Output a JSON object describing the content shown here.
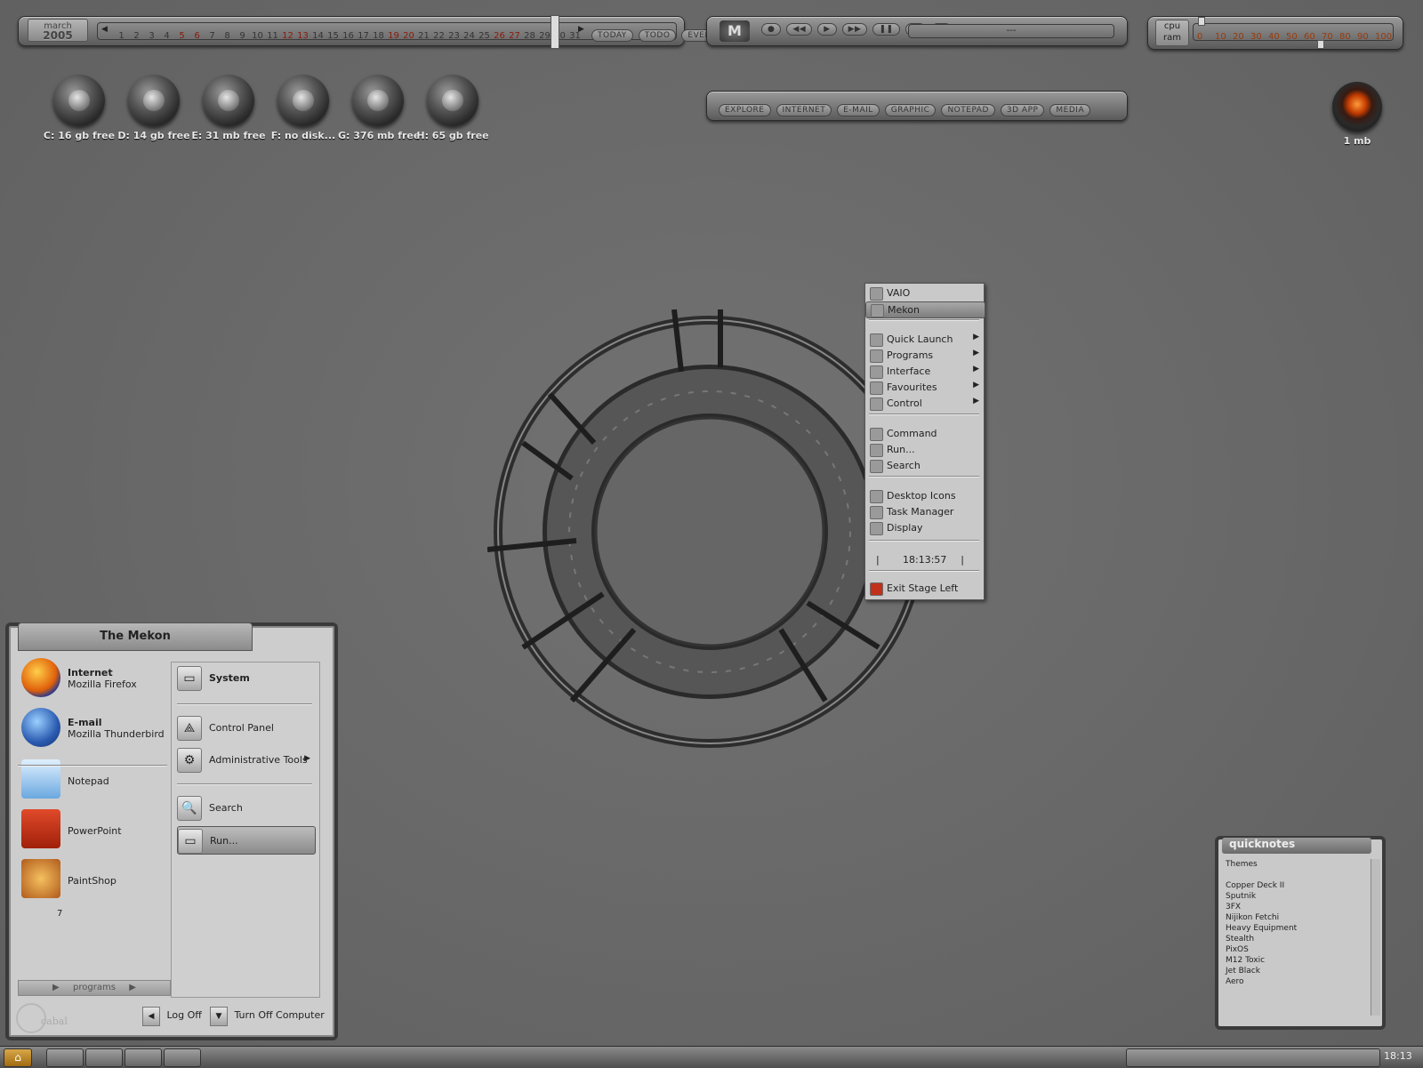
{
  "calendar": {
    "month": "march",
    "year": "2005",
    "days": [
      "1",
      "2",
      "3",
      "4",
      "5",
      "6",
      "7",
      "8",
      "9",
      "10",
      "11",
      "12",
      "13",
      "14",
      "15",
      "16",
      "17",
      "18",
      "19",
      "20",
      "21",
      "22",
      "23",
      "24",
      "25",
      "26",
      "27",
      "28",
      "29",
      "30",
      "31"
    ],
    "red_days": [
      "5",
      "6",
      "12",
      "13",
      "19",
      "20",
      "26",
      "27"
    ],
    "buttons": [
      "TODAY",
      "TODO",
      "EVENTS"
    ]
  },
  "media": {
    "track": "---",
    "logo": "M"
  },
  "monitor": {
    "label1": "cpu",
    "label2": "ram",
    "scale": [
      "0",
      "10",
      "20",
      "30",
      "40",
      "50",
      "60",
      "70",
      "80",
      "90",
      "100"
    ]
  },
  "launch_bar": [
    "EXPLORE",
    "INTERNET",
    "E-MAIL",
    "GRAPHIC",
    "NOTEPAD",
    "3D APP",
    "MEDIA"
  ],
  "drives": [
    {
      "label": "C: 16 gb free"
    },
    {
      "label": "D: 14 gb free"
    },
    {
      "label": "E: 31 mb free"
    },
    {
      "label": "F: no disk..."
    },
    {
      "label": "G: 376 mb free"
    },
    {
      "label": "H: 65 gb free"
    }
  ],
  "recycle": {
    "label": "1 mb"
  },
  "context_menu": {
    "items": [
      {
        "label": "VAIO"
      },
      {
        "label": "Mekon"
      },
      {
        "label": "Quick Launch",
        "sub": true
      },
      {
        "label": "Programs",
        "sub": true
      },
      {
        "label": "Interface",
        "sub": true
      },
      {
        "label": "Favourites",
        "sub": true
      },
      {
        "label": "Control",
        "sub": true
      },
      {
        "label": "Command"
      },
      {
        "label": "Run..."
      },
      {
        "label": "Search"
      },
      {
        "label": "Desktop Icons"
      },
      {
        "label": "Task Manager"
      },
      {
        "label": "Display"
      },
      {
        "label": "Exit Stage Left"
      }
    ],
    "clock": "18:13:57"
  },
  "start_menu": {
    "title": "The Mekon",
    "left": [
      {
        "title": "Internet",
        "sub": "Mozilla Firefox"
      },
      {
        "title": "E-mail",
        "sub": "Mozilla Thunderbird"
      },
      {
        "title": "",
        "sub": "Notepad"
      },
      {
        "title": "",
        "sub": "PowerPoint"
      },
      {
        "title": "",
        "sub": "PaintShop"
      }
    ],
    "right": [
      {
        "label": "System"
      },
      {
        "label": "Control Panel"
      },
      {
        "label": "Administrative Tools"
      },
      {
        "label": "Search"
      },
      {
        "label": "Run..."
      }
    ],
    "programs": "programs",
    "logoff": "Log Off",
    "turnoff": "Turn Off Computer",
    "brand": "cabal",
    "badge": "7"
  },
  "quicknotes": {
    "title": "quicknotes",
    "heading": "Themes",
    "lines": [
      "Copper Deck II",
      "Sputnik",
      "3FX",
      "Nijikon Fetchi",
      "Heavy Equipment",
      "Stealth",
      "PixOS",
      "M12 Toxic",
      "Jet Black",
      "Aero"
    ]
  },
  "taskbar": {
    "clock": "18:13"
  }
}
